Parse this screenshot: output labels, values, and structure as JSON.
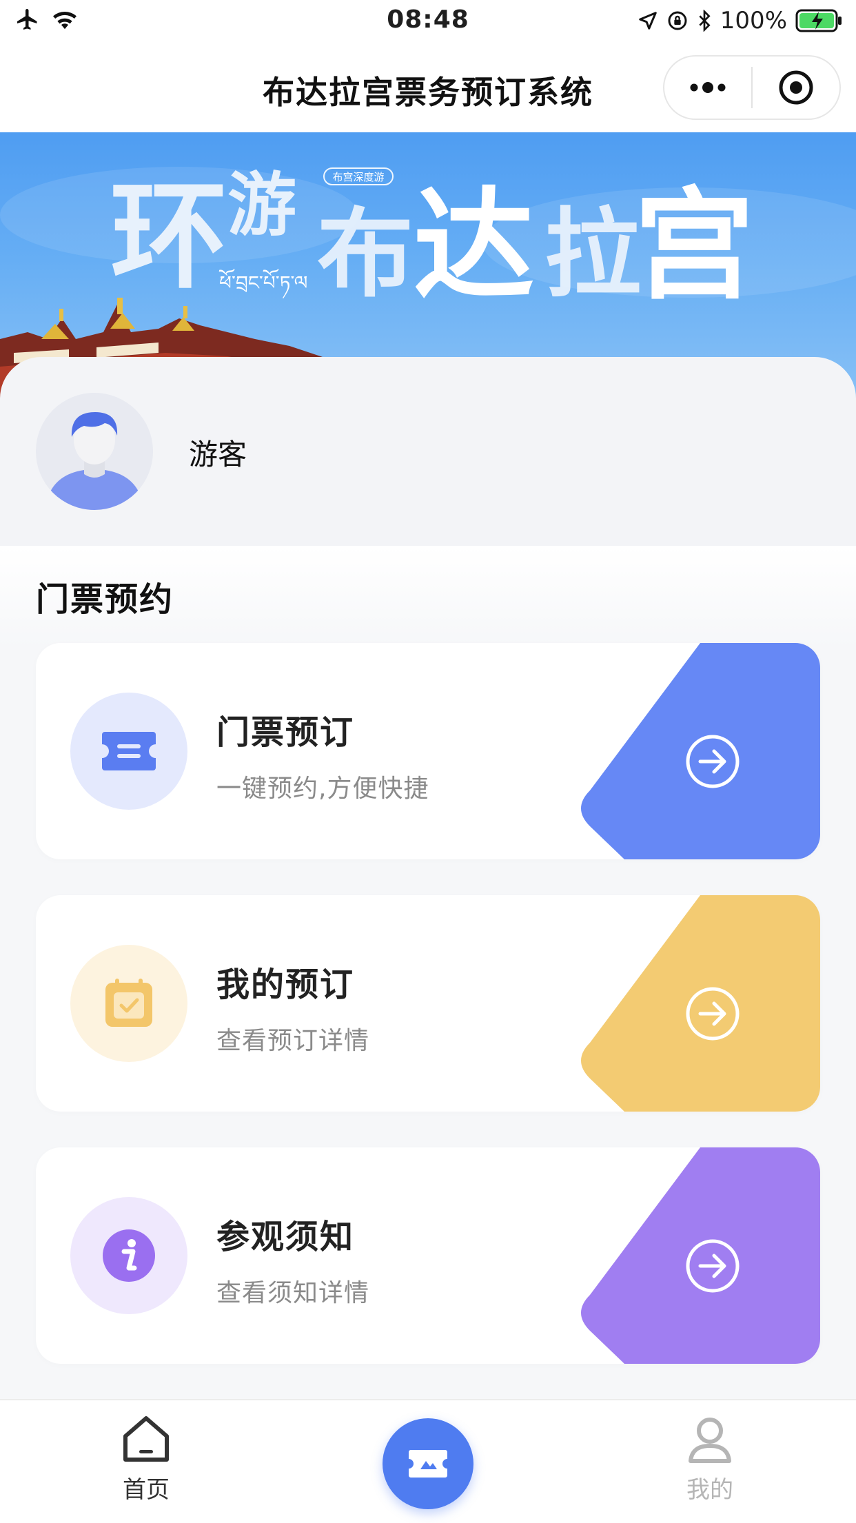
{
  "status_bar": {
    "time": "08:48",
    "battery_percent": "100%"
  },
  "nav": {
    "title": "布达拉宫票务预订系统"
  },
  "banner": {
    "title_chars": [
      "环",
      "游",
      "布",
      "达",
      "拉",
      "宫"
    ],
    "badge": "布宫深度游",
    "subtitle_tibetan": "ཕོ་བྲང་པོ་ཏ་ལ"
  },
  "profile": {
    "name": "游客"
  },
  "section": {
    "title": "门票预约"
  },
  "cards": [
    {
      "title": "门票预订",
      "subtitle": "一键预约,方便快捷",
      "icon": "ticket-icon",
      "color": "#6688f5",
      "circle": "#e4e9fd"
    },
    {
      "title": "我的预订",
      "subtitle": "查看预订详情",
      "icon": "calendar-check-icon",
      "color": "#f3cb72",
      "circle": "#fdf3df"
    },
    {
      "title": "参观须知",
      "subtitle": "查看须知详情",
      "icon": "info-icon",
      "color": "#a07ef1",
      "circle": "#efe8fd"
    }
  ],
  "tabbar": {
    "home_label": "首页",
    "mine_label": "我的",
    "active_color": "#333333",
    "inactive_color": "#b5b5b5",
    "center_color": "#4f7cf0"
  }
}
